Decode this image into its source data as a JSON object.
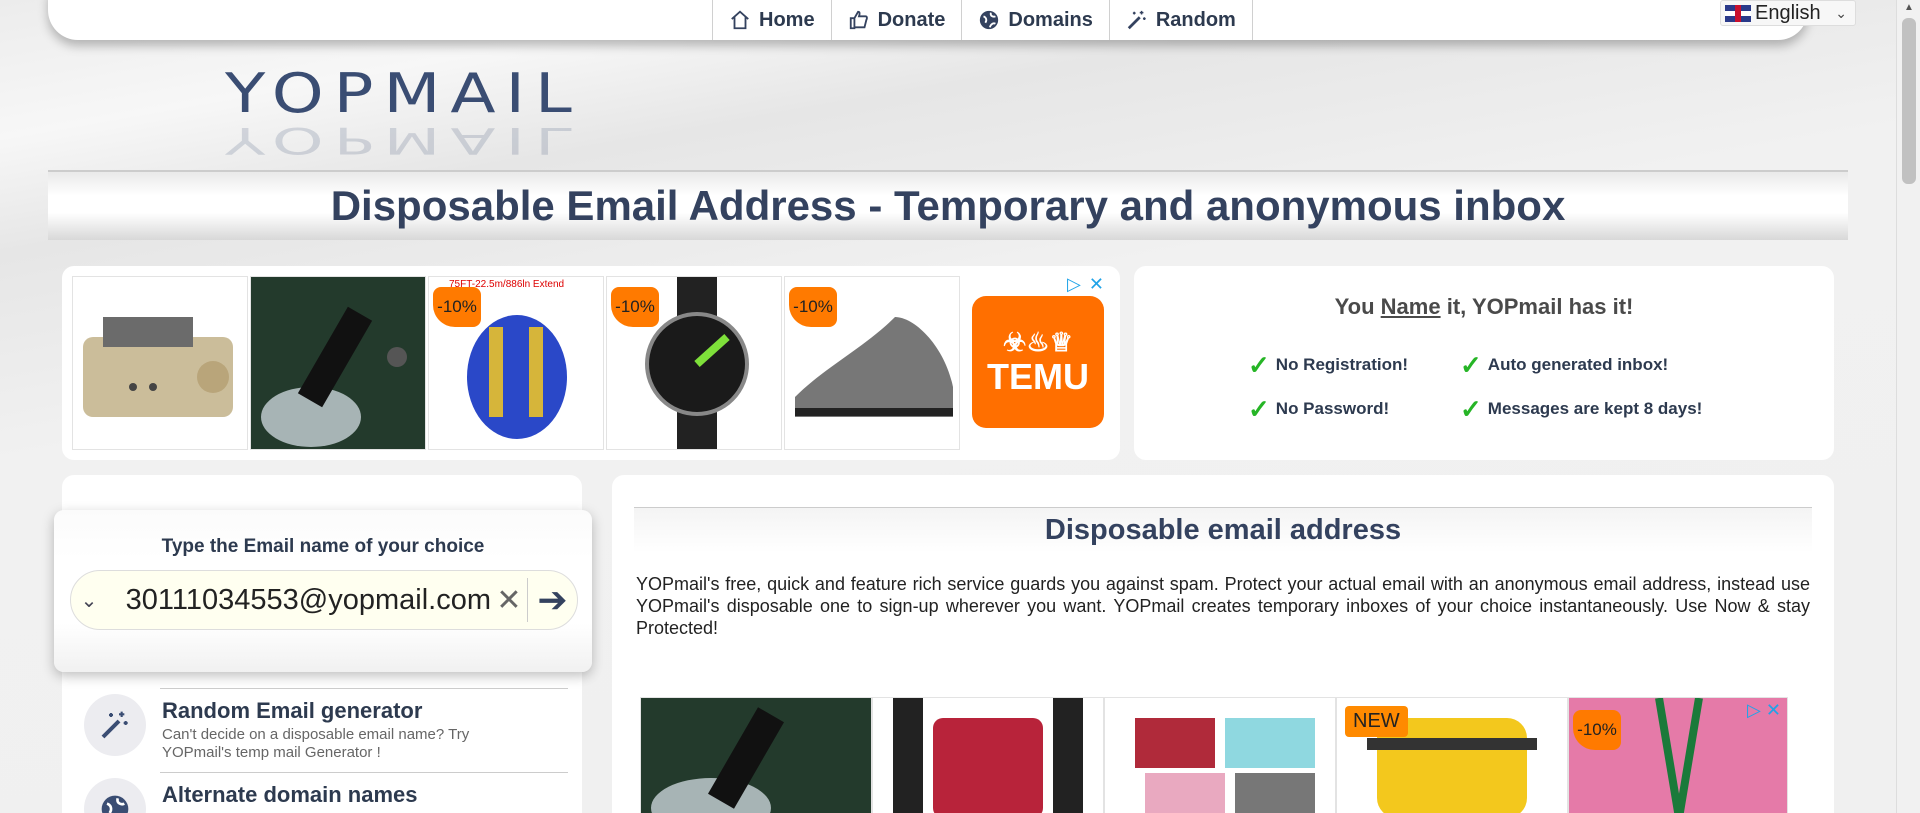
{
  "nav": {
    "items": [
      {
        "label": "Home",
        "icon": "home-icon"
      },
      {
        "label": "Donate",
        "icon": "thumbs-up-icon"
      },
      {
        "label": "Domains",
        "icon": "globe-icon"
      },
      {
        "label": "Random",
        "icon": "magic-wand-icon"
      }
    ],
    "language": "English"
  },
  "logo": {
    "text": "YOPMAIL"
  },
  "page_title": "Disposable Email Address - Temporary and anonymous inbox",
  "ad_banner": {
    "badges": [
      "-10%",
      "-10%",
      "-10%"
    ],
    "small_text": "75FT-22.5m/886ln Extend",
    "brand": "TEMU"
  },
  "features": {
    "title_pre": "You ",
    "title_name": "Name",
    "title_post": " it, YOPmail has it!",
    "items": [
      "No Registration!",
      "Auto generated inbox!",
      "No Password!",
      "Messages are kept 8 days!"
    ]
  },
  "email_box": {
    "label": "Type the Email name of your choice",
    "value": "30111034553@yopmail.com"
  },
  "side": {
    "random": {
      "title": "Random Email generator",
      "desc": "Can't decide on a disposable email name? Try YOPmail's temp mail Generator !"
    },
    "alternate": {
      "title": "Alternate domain names"
    }
  },
  "main": {
    "heading": "Disposable email address",
    "text": "YOPmail's free, quick and feature rich service guards you against spam. Protect your actual email with an anonymous email address, instead use YOPmail's disposable one to sign-up wherever you want. YOPmail creates temporary inboxes of your choice instantaneously. Use Now & stay Protected!"
  },
  "ad_row2": {
    "badge_new": "NEW",
    "badge_discount": "-10%"
  },
  "colors": {
    "accent": "#34425f",
    "check": "#26b526",
    "badge": "#ff7a00"
  }
}
